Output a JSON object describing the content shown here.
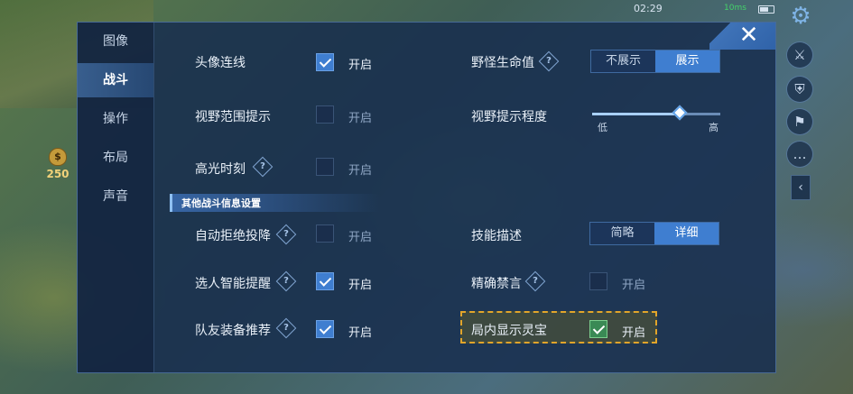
{
  "hud": {
    "clock": "02:29",
    "ping": "10ms",
    "gold": "250",
    "gold_icon": "$"
  },
  "side_icons": {
    "gear": "⚙",
    "sword": "⚔",
    "shield": "⛨",
    "flag": "⚑",
    "chat": "…",
    "collapse": "‹"
  },
  "close_label": "✕",
  "nav": {
    "items": [
      "图像",
      "战斗",
      "操作",
      "布局",
      "声音"
    ],
    "active": "战斗"
  },
  "settings": {
    "row_head": {
      "label": "头像连线",
      "on": "开启"
    },
    "vision_range": {
      "label": "视野范围提示",
      "on": "开启"
    },
    "highlight_moment": {
      "label": "高光时刻",
      "on": "开启"
    },
    "section_title": "其他战斗信息设置",
    "auto_reject_surrender": {
      "label": "自动拒绝投降",
      "on": "开启"
    },
    "smart_pick_remind": {
      "label": "选人智能提醒",
      "on": "开启"
    },
    "teammate_equip": {
      "label": "队友装备推荐",
      "on": "开启"
    },
    "target_hp": {
      "label": "野怪生命值",
      "options": [
        "不展示",
        "展示"
      ],
      "selected": "展示"
    },
    "vision_level": {
      "label": "视野提示程度",
      "low": "低",
      "high": "高",
      "value_fraction": 0.68
    },
    "skill_desc": {
      "label": "技能描述",
      "options": [
        "简略",
        "详细"
      ],
      "selected": "详细"
    },
    "precise_mute": {
      "label": "精确禁言",
      "on": "开启"
    },
    "show_spirit": {
      "label": "局内显示灵宝",
      "on": "开启"
    }
  },
  "colors": {
    "panel": "#172d4e",
    "accent": "#3f7ed0",
    "highlight": "#e2a52a"
  }
}
